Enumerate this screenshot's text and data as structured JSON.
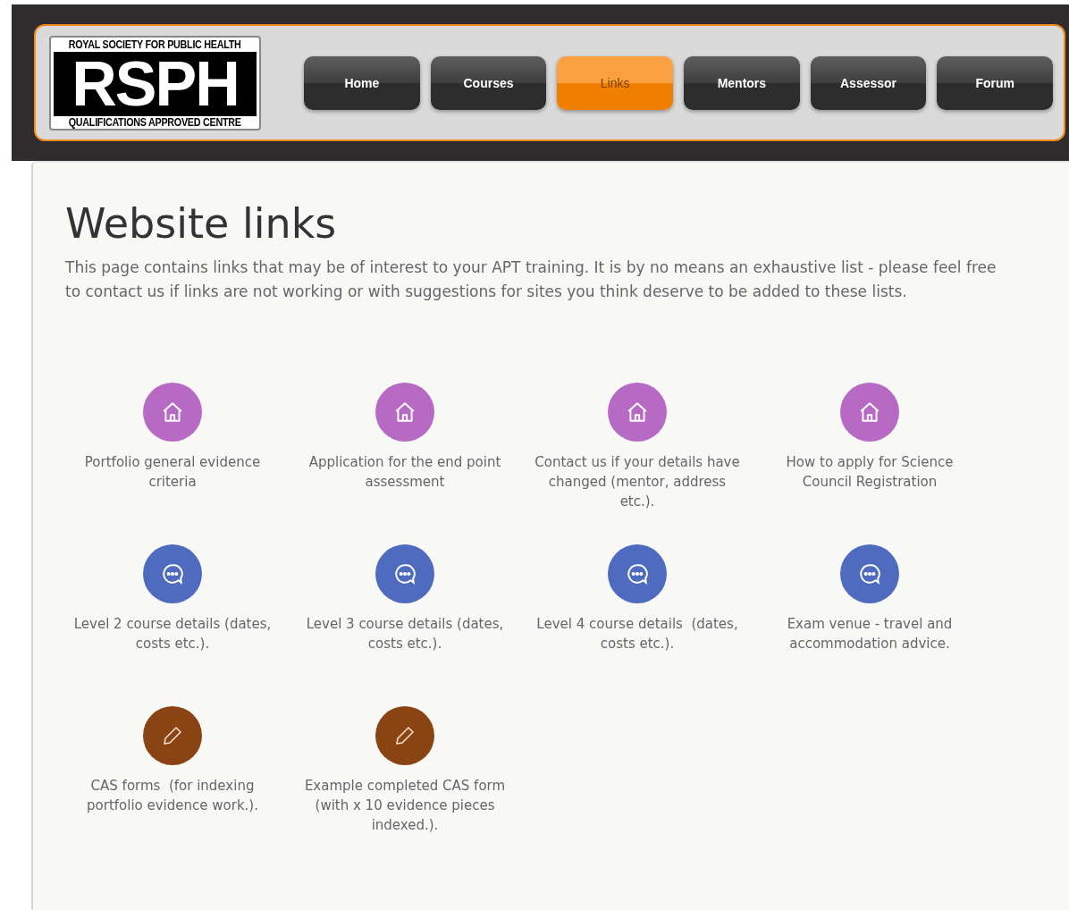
{
  "logo": {
    "top": "ROYAL SOCIETY FOR PUBLIC HEALTH",
    "main": "RSPH",
    "bottom": "QUALIFICATIONS APPROVED CENTRE"
  },
  "nav": [
    {
      "label": "Home",
      "selected": false
    },
    {
      "label": "Courses",
      "selected": false
    },
    {
      "label": "Links",
      "selected": true
    },
    {
      "label": "Mentors",
      "selected": false
    },
    {
      "label": "Assessor",
      "selected": false
    },
    {
      "label": "Forum",
      "selected": false
    }
  ],
  "heading": "Website links",
  "intro": "This page contains links that may be of interest to your APT training. It is by no means an exhaustive list - please feel free to contact us if links are not working or with suggestions for sites you think deserve to be added to these lists.",
  "links": [
    {
      "kind": "home",
      "color": "#b66ac4",
      "label": "Portfolio general evidence criteria"
    },
    {
      "kind": "home",
      "color": "#b66ac4",
      "label": "Application for the end point assessment"
    },
    {
      "kind": "home",
      "color": "#b66ac4",
      "label": "Contact us if your details have changed (mentor, address etc.)."
    },
    {
      "kind": "home",
      "color": "#b66ac4",
      "label": "How to apply for Science Council Registration"
    },
    {
      "kind": "chat",
      "color": "#4f6bbf",
      "label": "Level 2 course details (dates, costs etc.)."
    },
    {
      "kind": "chat",
      "color": "#4f6bbf",
      "label": "Level 3 course details (dates, costs etc.)."
    },
    {
      "kind": "chat",
      "color": "#4f6bbf",
      "label": "Level 4 course details  (dates, costs etc.)."
    },
    {
      "kind": "chat",
      "color": "#4f6bbf",
      "label": "Exam venue - travel and accommodation advice."
    },
    {
      "kind": "pencil",
      "color": "#8a4414",
      "label": "CAS forms  (for indexing portfolio evidence work.)."
    },
    {
      "kind": "pencil",
      "color": "#8a4414",
      "label": "Example completed CAS form  (with x 10 evidence pieces indexed.)."
    }
  ]
}
